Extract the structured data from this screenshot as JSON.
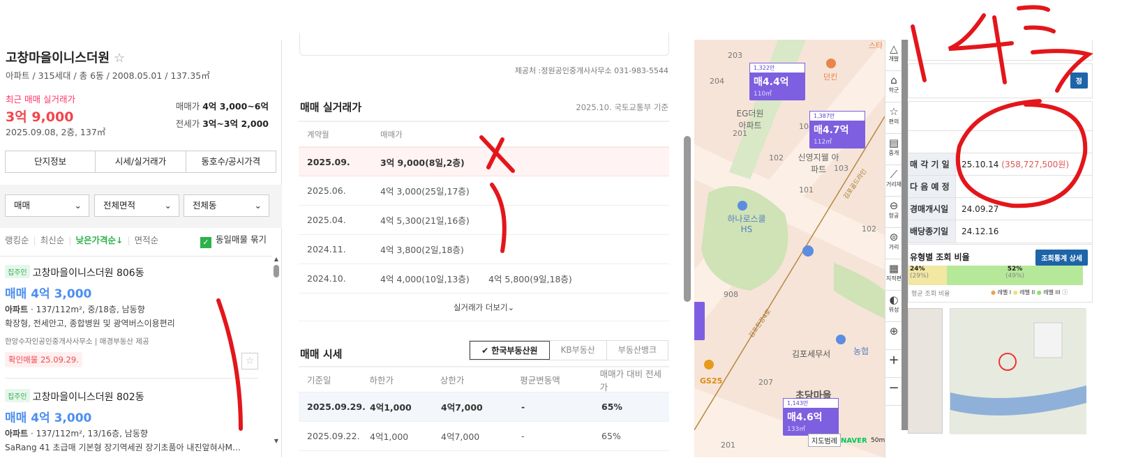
{
  "complex": {
    "name": "고창마을이니스더원",
    "star": "☆",
    "meta": "아파트 / 315세대 / 총 6동 / 2008.05.01 / 137.35㎡",
    "recent_label": "최근 매매 실거래가",
    "recent_price": "3억 9,000",
    "recent_detail": "2025.09.08, 2층, 137㎡",
    "sale_label": "매매가",
    "sale_range": "4억 3,000~6억",
    "jeonse_label": "전세가",
    "jeonse_range": "3억~3억 2,000",
    "tabs": [
      "단지정보",
      "시세/실거래가",
      "동호수/공시가격"
    ]
  },
  "filters": {
    "type": "매매",
    "area": "전체면적",
    "dong": "전체동"
  },
  "sort": {
    "items": [
      "랭킹순",
      "최신순",
      "낮은가격순↓",
      "면적순"
    ],
    "group_label": "동일매물 묶기"
  },
  "listings": [
    {
      "badge": "집주인",
      "name": "고창마을이니스더원 806동",
      "price": "매매 4억 3,000",
      "type": "아파트",
      "spec": " · 137/112m², 중/18층, 남동향",
      "desc": "확장형, 전세안고, 종합병원 및 광역버스이용편리",
      "source": "한앙수자인공인중개사사무소 | 매경부동산 제공",
      "confirm": "확인매물 25.09.29."
    },
    {
      "badge": "집주인",
      "name": "고창마을이니스더원 802동",
      "price": "매매 4억 3,000",
      "type": "아파트",
      "spec": " · 137/112m², 13/16층, 남동향",
      "desc": "SaRang 41 초급매 기본형 장기역세권 장기초품아 내진앞혀사M…"
    }
  ],
  "middle": {
    "provider": "제공처 :정원공인중개사사무소 031-983-5544",
    "trades_title": "매매 실거래가",
    "trades_basis": "2025.10. 국토교통부 기준",
    "trades_headers": [
      "계약월",
      "매매가"
    ],
    "trades": [
      {
        "month": "2025.09.",
        "prices": [
          "3억 9,000(8일,2층)"
        ]
      },
      {
        "month": "2025.06.",
        "prices": [
          "4억 3,000(25일,17층)"
        ]
      },
      {
        "month": "2025.04.",
        "prices": [
          "4억 5,300(21일,16층)"
        ]
      },
      {
        "month": "2024.11.",
        "prices": [
          "4억 3,800(2일,18층)"
        ]
      },
      {
        "month": "2024.10.",
        "prices": [
          "4억 4,000(10일,13층)",
          "4억 5,800(9일,18층)"
        ]
      }
    ],
    "more": "실거래가 더보기⌄",
    "market_title": "매매 시세",
    "sources": [
      "✔ 한국부동산원",
      "KB부동산",
      "부동산뱅크"
    ],
    "market_headers": [
      "기준일",
      "하한가",
      "상한가",
      "평균변동액",
      "매매가 대비 전세가"
    ],
    "market": [
      [
        "2025.09.29.",
        "4억1,000",
        "4억7,000",
        "-",
        "65%"
      ],
      [
        "2025.09.22.",
        "4억1,000",
        "4억7,000",
        "-",
        "65%"
      ]
    ]
  },
  "map": {
    "markers": [
      {
        "unit": "1,322만",
        "price": "매4.4억",
        "area": "110㎡"
      },
      {
        "unit": "1,387만",
        "price": "매4.7억",
        "area": "112㎡"
      },
      {
        "unit": "1,143만",
        "price": "매4.6억",
        "area": "133㎡"
      }
    ],
    "labels": [
      "203",
      "204",
      "EG더원 아파트",
      "201",
      "104",
      "102",
      "신영지웰 아파트",
      "103",
      "101",
      "하나로스쿨 HS",
      "102",
      "908",
      "김포세무서",
      "농협",
      "GS25",
      "207",
      "초당마을",
      "201",
      "던킨",
      "스타",
      "김포골드라인",
      "김포한강4로"
    ],
    "legend": "지도범례",
    "brand": "NAVER",
    "scale": "50m",
    "tools": [
      "개발",
      "학군",
      "편의",
      "중개",
      "거리재",
      "항공",
      "거리",
      "지적편",
      "위성"
    ]
  },
  "right": {
    "btn": "정",
    "rows": [
      {
        "k": "매 각 기 일",
        "v": "25.10.14",
        "v2": "(358,727,500원)"
      },
      {
        "k": "다 음 예 정",
        "v": ""
      },
      {
        "k": "경매개시일",
        "v": "24.09.27"
      },
      {
        "k": "배당종기일",
        "v": "24.12.16"
      }
    ],
    "ratio_title": "유형별 조회 비율",
    "ratio_btn": "조회통계 상세",
    "bar1": "24%",
    "bar1b": "(29%)",
    "bar2": "52%",
    "bar2b": "(49%)",
    "avg_label": "평균 조회 비율",
    "levels": [
      "레벨 I",
      "레벨 II",
      "레벨 III"
    ]
  }
}
